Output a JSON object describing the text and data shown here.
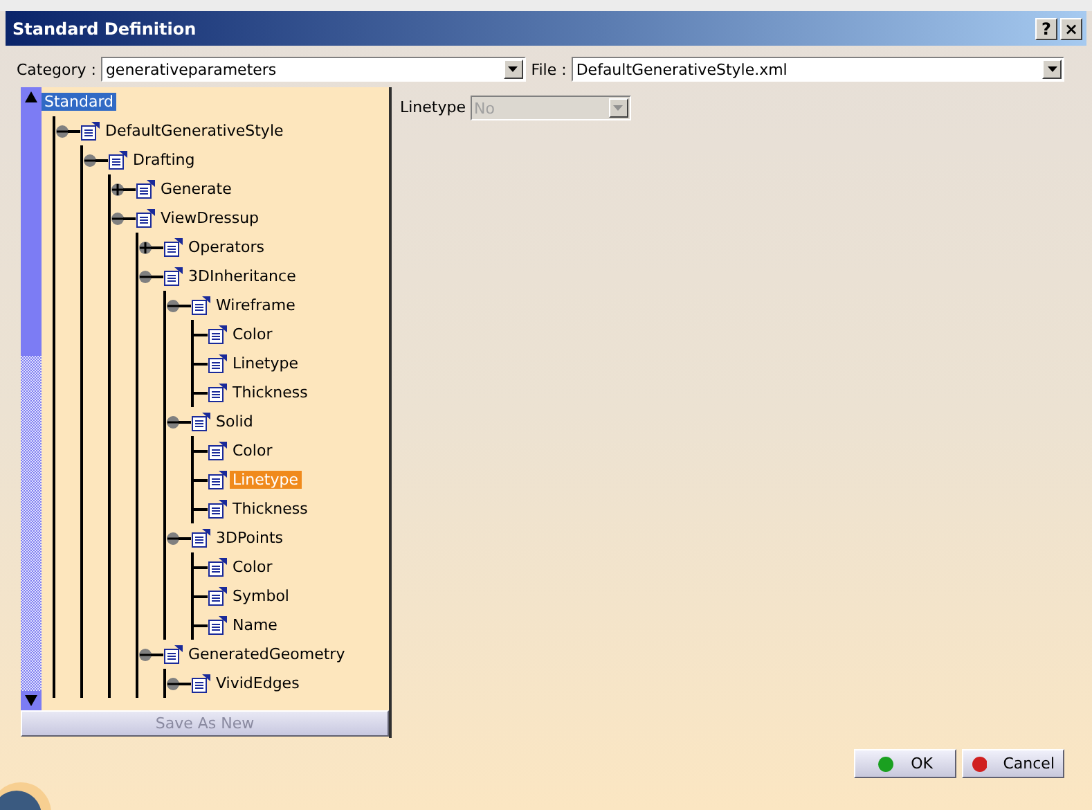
{
  "window": {
    "title": "Standard Definition",
    "buttons": [
      "?",
      "×"
    ]
  },
  "category": {
    "label": "Category :",
    "value": "generativeparameters"
  },
  "file": {
    "label": "File :",
    "value": "DefaultGenerativeStyle.xml"
  },
  "tree": [
    {
      "label": "Standard",
      "selected": true,
      "children": [
        {
          "label": "DefaultGenerativeStyle",
          "selected": false,
          "expanded": true,
          "children": [
            {
              "label": "Drafting",
              "selected": false,
              "expanded": true,
              "children": [
                {
                  "label": "Generate",
                  "selected": false,
                  "expanded": false
                },
                {
                  "label": "ViewDressup",
                  "selected": false,
                  "expanded": true,
                  "children": [
                    {
                      "label": "Operators",
                      "selected": false,
                      "expanded": false
                    },
                    {
                      "label": "3DInheritance",
                      "selected": false,
                      "expanded": true,
                      "children": [
                        {
                          "label": "Wireframe",
                          "selected": false,
                          "expanded": true,
                          "children": [
                            {
                              "label": "Color",
                              "selected": false
                            },
                            {
                              "label": "Linetype",
                              "selected": false
                            },
                            {
                              "label": "Thickness",
                              "selected": false
                            }
                          ]
                        },
                        {
                          "label": "Solid",
                          "selected": false,
                          "expanded": true,
                          "children": [
                            {
                              "label": "Color",
                              "selected": false
                            },
                            {
                              "label": "Linetype",
                              "selected": true
                            },
                            {
                              "label": "Thickness",
                              "selected": false
                            }
                          ]
                        },
                        {
                          "label": "3DPoints",
                          "selected": false,
                          "expanded": true,
                          "children": [
                            {
                              "label": "Color",
                              "selected": false
                            },
                            {
                              "label": "Symbol",
                              "selected": false
                            },
                            {
                              "label": "Name",
                              "selected": false
                            }
                          ]
                        }
                      ]
                    },
                    {
                      "label": "GeneratedGeometry",
                      "selected": false,
                      "expanded": true,
                      "children": [
                        {
                          "label": "VividEdges",
                          "selected": false,
                          "expanded": true
                        }
                      ]
                    }
                  ]
                }
              ]
            }
          ]
        }
      ]
    }
  ],
  "save_button": {
    "label": "Save As New",
    "disabled": true
  },
  "property": {
    "label": "Linetype",
    "value": "No",
    "disabled": true
  },
  "buttons": [
    {
      "kind": "ok",
      "label": "OK"
    },
    {
      "kind": "cancel",
      "label": "Cancel"
    }
  ]
}
